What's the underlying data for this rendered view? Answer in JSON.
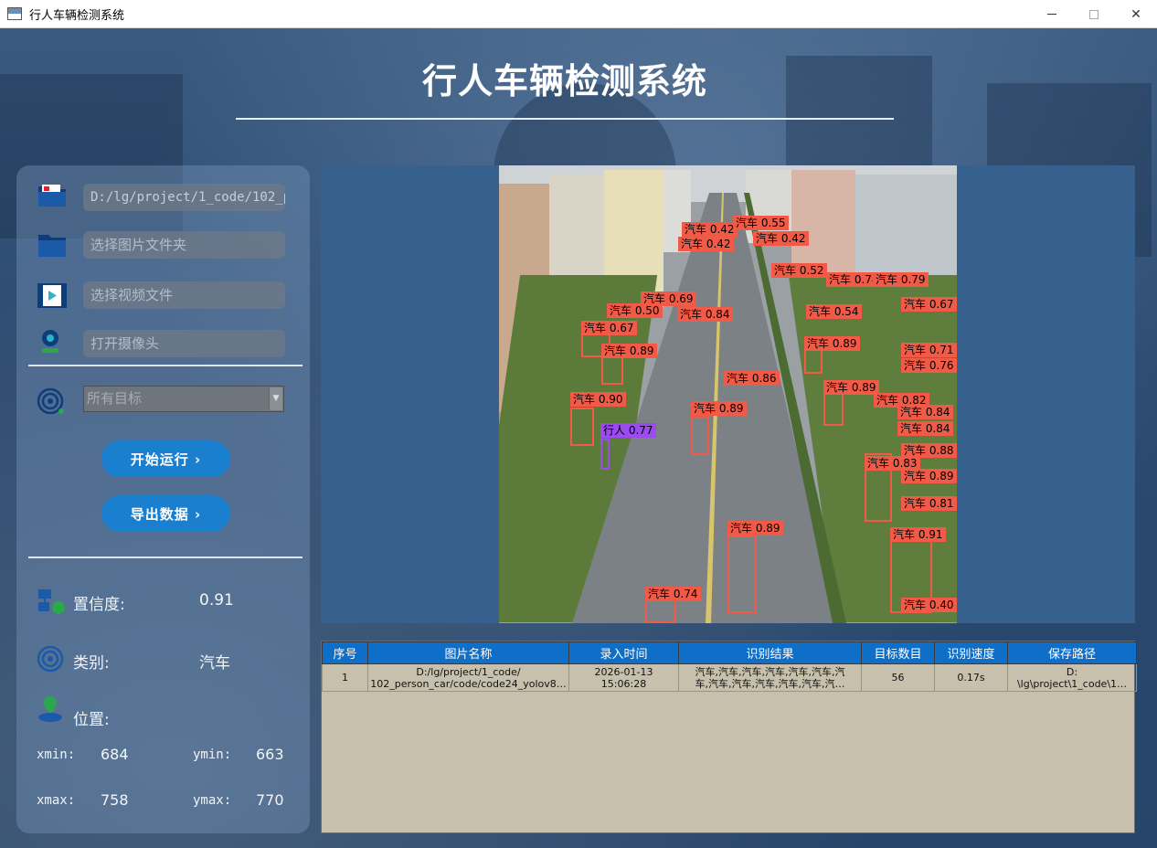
{
  "window": {
    "title": "行人车辆检测系统"
  },
  "header": {
    "title": "行人车辆检测系统"
  },
  "sources": {
    "image_path": "D:/lg/project/1_code/102_pe",
    "folder_placeholder": "选择图片文件夹",
    "video_placeholder": "选择视频文件",
    "camera_placeholder": "打开摄像头"
  },
  "target_select": {
    "value": "所有目标"
  },
  "buttons": {
    "run": "开始运行 ›",
    "export": "导出数据 ›"
  },
  "info": {
    "confidence_label": "置信度:",
    "confidence_value": "0.91",
    "class_label": "类别:",
    "class_value": "汽车",
    "position_label": "位置:",
    "xmin_label": "xmin:",
    "xmin_value": "684",
    "ymin_label": "ymin:",
    "ymin_value": "663",
    "xmax_label": "xmax:",
    "xmax_value": "758",
    "ymax_label": "ymax:",
    "ymax_value": "770"
  },
  "table": {
    "headers": [
      "序号",
      "图片名称",
      "录入时间",
      "识别结果",
      "目标数目",
      "识别速度",
      "保存路径"
    ],
    "rows": [
      {
        "index": "1",
        "name_line1": "D:/lg/project/1_code/",
        "name_line2": "102_person_car/code/code24_yolov8…",
        "time_line1": "2026-01-13",
        "time_line2": "15:06:28",
        "result_line1": "汽车,汽车,汽车,汽车,汽车,汽车,汽",
        "result_line2": "车,汽车,汽车,汽车,汽车,汽车,汽…",
        "count": "56",
        "speed": "0.17s",
        "path_line1": "D:",
        "path_line2": "\\lg\\project\\1_code\\1…"
      }
    ]
  },
  "detections": [
    {
      "label": "汽车 0.42"
    },
    {
      "label": "汽车 0.55"
    },
    {
      "label": "汽车 0.42"
    },
    {
      "label": "汽车 0.42"
    },
    {
      "label": "汽车 0.52"
    },
    {
      "label": "汽车 0.78"
    },
    {
      "label": "汽车 0.79"
    },
    {
      "label": "汽车 0.69"
    },
    {
      "label": "汽车 0.50"
    },
    {
      "label": "汽车 0.84"
    },
    {
      "label": "汽车 0.54"
    },
    {
      "label": "汽车 0.67"
    },
    {
      "label": "汽车 0.67"
    },
    {
      "label": "汽车 0.89"
    },
    {
      "label": "汽车 0.89"
    },
    {
      "label": "汽车 0.71"
    },
    {
      "label": "汽车 0.76"
    },
    {
      "label": "汽车 0.86"
    },
    {
      "label": "汽车 0.89"
    },
    {
      "label": "汽车 0.82"
    },
    {
      "label": "汽车 0.90"
    },
    {
      "label": "汽车 0.89"
    },
    {
      "label": "汽车 0.84"
    },
    {
      "label": "汽车 0.84"
    },
    {
      "label": "行人 0.77",
      "class": "person"
    },
    {
      "label": "汽车 0.88"
    },
    {
      "label": "汽车 0.89"
    },
    {
      "label": "汽车 0.81"
    },
    {
      "label": "汽车 0.89"
    },
    {
      "label": "汽车 0.91"
    },
    {
      "label": "汽车 0.74"
    },
    {
      "label": "汽车 0.40"
    },
    {
      "label": "汽车 0.83"
    }
  ],
  "colors": {
    "accent": "#1a7fcf",
    "box_car": "#f05a46",
    "box_person": "#9a4cf0",
    "table_header": "#0f6fc8"
  }
}
